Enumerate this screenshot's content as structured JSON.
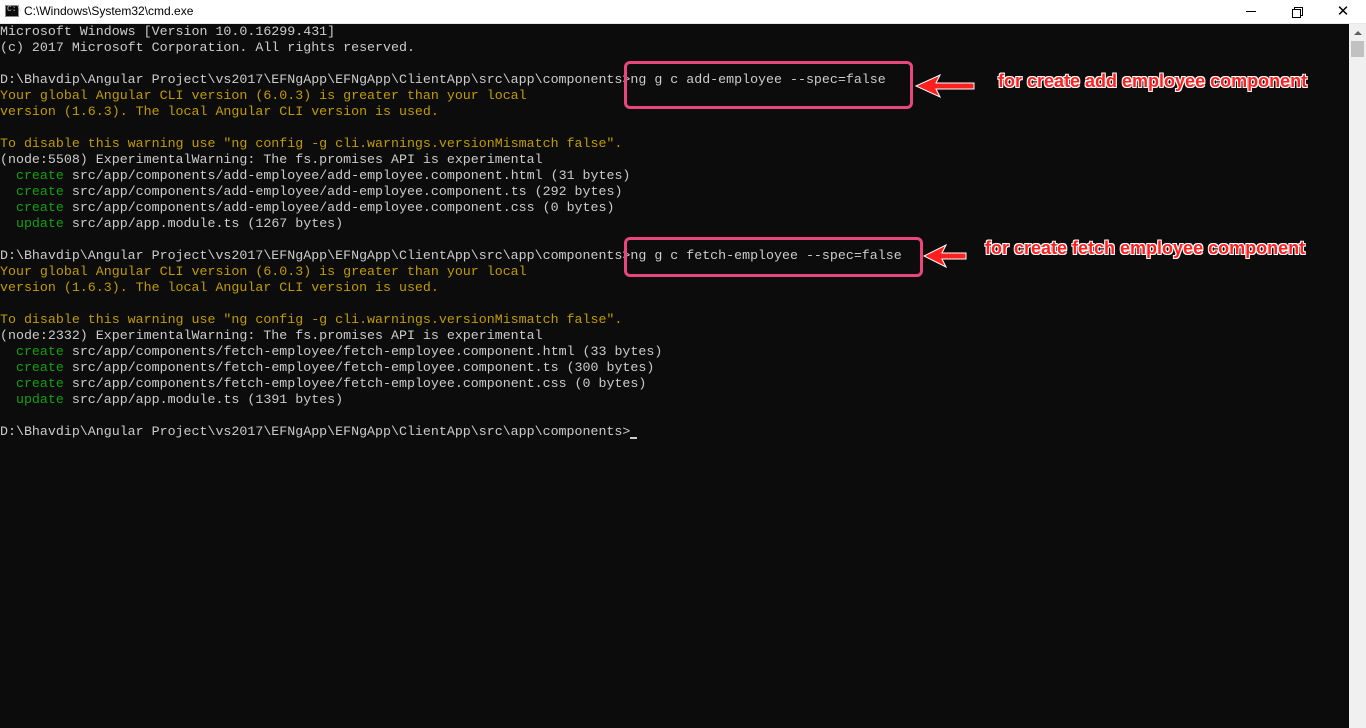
{
  "window": {
    "title": "C:\\Windows\\System32\\cmd.exe",
    "icon_label": "C:\\",
    "controls": [
      "minimize-icon",
      "maximize-icon",
      "close-icon"
    ]
  },
  "colors": {
    "background": "#0c0c0c",
    "text": "#cccccc",
    "warning": "#c19c00",
    "create": "#13a10e",
    "annotation": "#e8467c",
    "annotation_text": "#ff1f1f"
  },
  "console": {
    "lines": [
      {
        "text": "Microsoft Windows [Version 10.0.16299.431]"
      },
      {
        "text": "(c) 2017 Microsoft Corporation. All rights reserved."
      },
      {
        "text": ""
      },
      {
        "prompt": "D:\\Bhavdip\\Angular Project\\vs2017\\EFNgApp\\EFNgApp\\ClientApp\\src\\app\\components>",
        "command": "ng g c add-employee --spec=false"
      },
      {
        "text": "Your global Angular CLI version (6.0.3) is greater than your local",
        "color": "yellow"
      },
      {
        "text": "version (1.6.3). The local Angular CLI version is used.",
        "color": "yellow"
      },
      {
        "text": ""
      },
      {
        "text": "To disable this warning use \"ng config -g cli.warnings.versionMismatch false\".",
        "color": "yellow"
      },
      {
        "text": "(node:5508) ExperimentalWarning: The fs.promises API is experimental"
      },
      {
        "verb": "create",
        "text": " src/app/components/add-employee/add-employee.component.html (31 bytes)"
      },
      {
        "verb": "create",
        "text": " src/app/components/add-employee/add-employee.component.ts (292 bytes)"
      },
      {
        "verb": "create",
        "text": " src/app/components/add-employee/add-employee.component.css (0 bytes)"
      },
      {
        "verb": "update",
        "text": " src/app/app.module.ts (1267 bytes)"
      },
      {
        "text": ""
      },
      {
        "prompt": "D:\\Bhavdip\\Angular Project\\vs2017\\EFNgApp\\EFNgApp\\ClientApp\\src\\app\\components>",
        "command": "ng g c fetch-employee --spec=false"
      },
      {
        "text": "Your global Angular CLI version (6.0.3) is greater than your local",
        "color": "yellow"
      },
      {
        "text": "version (1.6.3). The local Angular CLI version is used.",
        "color": "yellow"
      },
      {
        "text": ""
      },
      {
        "text": "To disable this warning use \"ng config -g cli.warnings.versionMismatch false\".",
        "color": "yellow"
      },
      {
        "text": "(node:2332) ExperimentalWarning: The fs.promises API is experimental"
      },
      {
        "verb": "create",
        "text": " src/app/components/fetch-employee/fetch-employee.component.html (33 bytes)"
      },
      {
        "verb": "create",
        "text": " src/app/components/fetch-employee/fetch-employee.component.ts (300 bytes)"
      },
      {
        "verb": "create",
        "text": " src/app/components/fetch-employee/fetch-employee.component.css (0 bytes)"
      },
      {
        "verb": "update",
        "text": " src/app/app.module.ts (1391 bytes)"
      },
      {
        "text": ""
      },
      {
        "prompt": "D:\\Bhavdip\\Angular Project\\vs2017\\EFNgApp\\EFNgApp\\ClientApp\\src\\app\\components>",
        "command": "",
        "cursor": true
      }
    ]
  },
  "annotations": [
    {
      "label": "for create add employee component"
    },
    {
      "label": "for create fetch employee component"
    }
  ]
}
